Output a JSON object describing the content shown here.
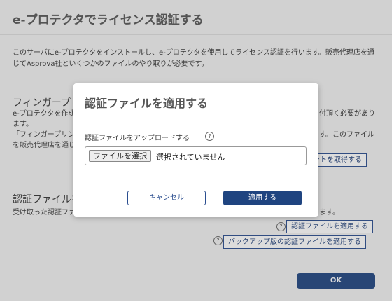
{
  "panel": {
    "title": "e-プロテクタでライセンス認証する",
    "intro_line1": "このサーバにe-プロテクタをインストールし、e-プロテクタを使用してライセンス認証を行います。販売代理店を通",
    "intro_line2": "じてAsprova社といくつかのファイルのやり取りが必要です。"
  },
  "fingerprint": {
    "title": "フィンガープリ",
    "line1_left": "e-プロテクタを作成",
    "line1_right": "付頂く必要があり",
    "line2": "ます。",
    "line3_left": "「フィンガープリン",
    "line3_right": "す。このファイル",
    "line4_left": "を販売代理店を通じ",
    "get_button": "ントを取得する"
  },
  "license_file": {
    "title": "認証ファイルを",
    "desc_left": "受け取った認証ファ",
    "desc_right": "ます。",
    "apply_link": "認証ファイルを適用する",
    "backup_link": "バックアップ版の認証ファイルを適用する"
  },
  "footer": {
    "ok": "OK"
  },
  "modal": {
    "title": "認証ファイルを適用する",
    "upload_label": "認証ファイルをアップロードする",
    "choose_file": "ファイルを選択",
    "no_file": "選択されていません",
    "cancel": "キャンセル",
    "apply": "適用する"
  },
  "icons": {
    "help": "?"
  }
}
